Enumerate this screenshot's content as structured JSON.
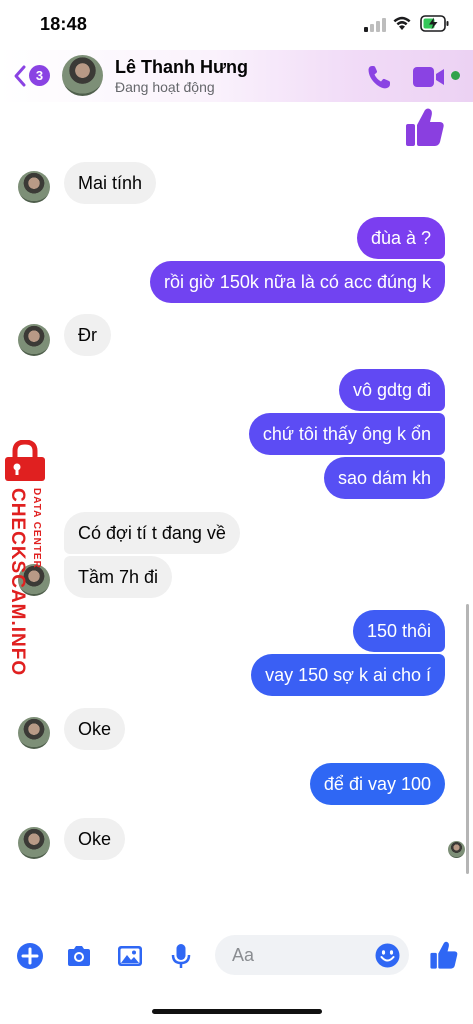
{
  "status_bar": {
    "time": "18:48",
    "battery_state": "charging"
  },
  "header": {
    "unread_count": "3",
    "contact_name": "Lê Thanh Hưng",
    "contact_status": "Đang hoạt động",
    "accent_color": "#8a43e3"
  },
  "messages": [
    {
      "side": "out",
      "type": "like-emoji"
    },
    {
      "side": "in",
      "text": "Mai tính"
    },
    {
      "side": "out",
      "text": "đùa à ?"
    },
    {
      "side": "out",
      "text": "rồi giờ 150k nữa là có acc đúng k"
    },
    {
      "side": "in",
      "text": "Đr"
    },
    {
      "side": "out",
      "text": "vô gdtg đi"
    },
    {
      "side": "out",
      "text": "chứ tôi thấy ông k ổn"
    },
    {
      "side": "out",
      "text": "sao dám kh"
    },
    {
      "side": "in",
      "text": "Có đợi tí t đang về"
    },
    {
      "side": "in",
      "text": "Tầm 7h đi"
    },
    {
      "side": "out",
      "text": "150 thôi"
    },
    {
      "side": "out",
      "text": "vay 150 sợ k ai cho í"
    },
    {
      "side": "in",
      "text": "Oke"
    },
    {
      "side": "out",
      "text": "để đi vay 100"
    },
    {
      "side": "in",
      "text": "Oke"
    }
  ],
  "watermark": {
    "main": "CHECKSCAM.INFO",
    "sub": "DATA CENTER"
  },
  "composer": {
    "placeholder": "Aa",
    "icons": [
      "plus-icon",
      "camera-icon",
      "gallery-icon",
      "microphone-icon",
      "emoji-icon",
      "like-icon"
    ]
  }
}
